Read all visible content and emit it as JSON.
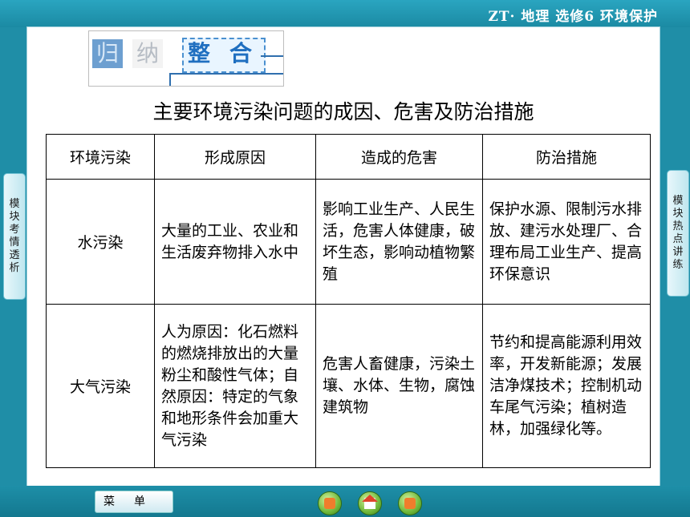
{
  "header": {
    "title": "ZT· 地理  选修6   环境保护"
  },
  "side_left": {
    "label": [
      "模",
      "块",
      "考",
      "情",
      "透",
      "析"
    ]
  },
  "side_right": {
    "label": [
      "模",
      "块",
      "热",
      "点",
      "讲",
      "练"
    ]
  },
  "badge": {
    "chars": [
      "归",
      "纳",
      "整",
      "合"
    ]
  },
  "page_title": "主要环境污染问题的成因、危害及防治措施",
  "table": {
    "headers": [
      "环境污染",
      "形成原因",
      "造成的危害",
      "防治措施"
    ],
    "rows": [
      {
        "type": "水污染",
        "cause": "大量的工业、农业和生活废弃物排入水中",
        "harm": "影响工业生产、人民生活，危害人体健康，破坏生态，影响动植物繁殖",
        "measures": "保护水源、限制污水排放、建污水处理厂、合理布局工业生产、提高环保意识"
      },
      {
        "type": "大气污染",
        "cause": "人为原因：化石燃料的燃烧排放出的大量粉尘和酸性气体；自然原因：特定的气象和地形条件会加重大气污染",
        "harm": "危害人畜健康，污染土壤、水体、生物，腐蚀建筑物",
        "measures": "节约和提高能源利用效率，开发新能源；发展洁净煤技术；控制机动车尾气污染；植树造林，加强绿化等。"
      }
    ]
  },
  "footer": {
    "menu_label": "菜单",
    "nav_icons": [
      "prev-icon",
      "home-icon",
      "next-icon"
    ]
  },
  "colors": {
    "frame": "#1f8ea7",
    "accent_blue": "#1f6fc0"
  }
}
